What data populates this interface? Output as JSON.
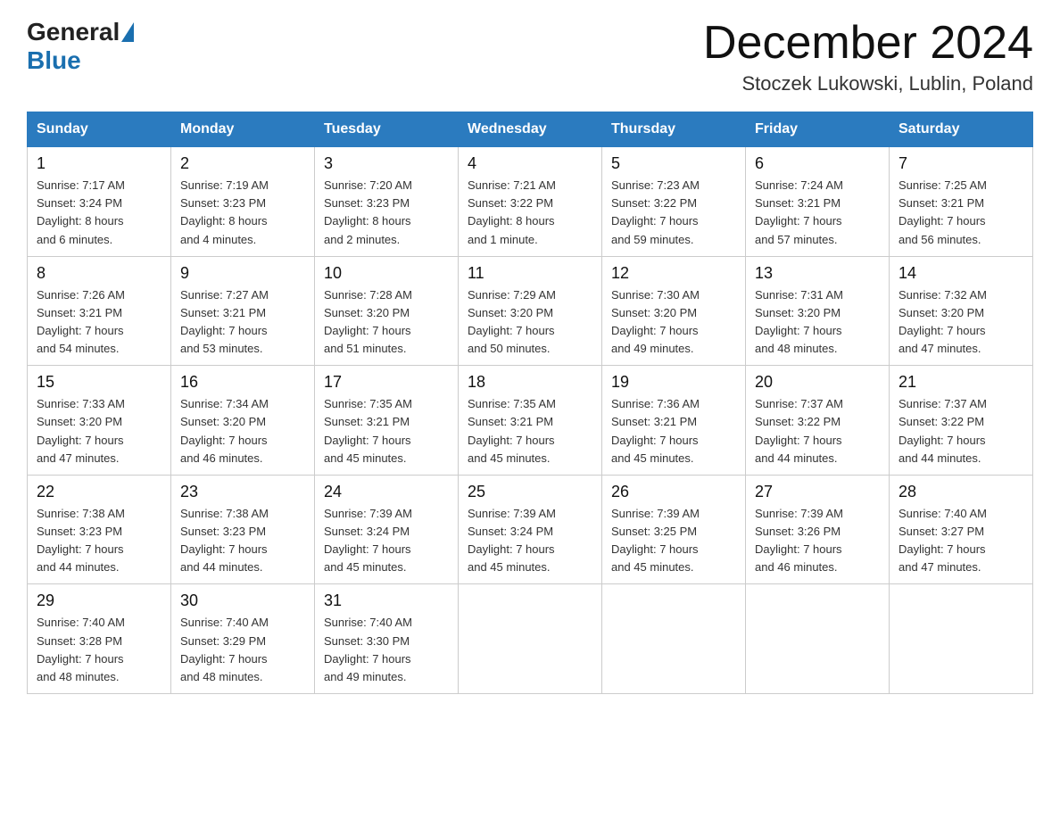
{
  "header": {
    "title": "December 2024",
    "location": "Stoczek Lukowski, Lublin, Poland",
    "logo_general": "General",
    "logo_blue": "Blue"
  },
  "days_of_week": [
    "Sunday",
    "Monday",
    "Tuesday",
    "Wednesday",
    "Thursday",
    "Friday",
    "Saturday"
  ],
  "weeks": [
    [
      {
        "day": "1",
        "sunrise": "7:17 AM",
        "sunset": "3:24 PM",
        "daylight": "8 hours and 6 minutes."
      },
      {
        "day": "2",
        "sunrise": "7:19 AM",
        "sunset": "3:23 PM",
        "daylight": "8 hours and 4 minutes."
      },
      {
        "day": "3",
        "sunrise": "7:20 AM",
        "sunset": "3:23 PM",
        "daylight": "8 hours and 2 minutes."
      },
      {
        "day": "4",
        "sunrise": "7:21 AM",
        "sunset": "3:22 PM",
        "daylight": "8 hours and 1 minute."
      },
      {
        "day": "5",
        "sunrise": "7:23 AM",
        "sunset": "3:22 PM",
        "daylight": "7 hours and 59 minutes."
      },
      {
        "day": "6",
        "sunrise": "7:24 AM",
        "sunset": "3:21 PM",
        "daylight": "7 hours and 57 minutes."
      },
      {
        "day": "7",
        "sunrise": "7:25 AM",
        "sunset": "3:21 PM",
        "daylight": "7 hours and 56 minutes."
      }
    ],
    [
      {
        "day": "8",
        "sunrise": "7:26 AM",
        "sunset": "3:21 PM",
        "daylight": "7 hours and 54 minutes."
      },
      {
        "day": "9",
        "sunrise": "7:27 AM",
        "sunset": "3:21 PM",
        "daylight": "7 hours and 53 minutes."
      },
      {
        "day": "10",
        "sunrise": "7:28 AM",
        "sunset": "3:20 PM",
        "daylight": "7 hours and 51 minutes."
      },
      {
        "day": "11",
        "sunrise": "7:29 AM",
        "sunset": "3:20 PM",
        "daylight": "7 hours and 50 minutes."
      },
      {
        "day": "12",
        "sunrise": "7:30 AM",
        "sunset": "3:20 PM",
        "daylight": "7 hours and 49 minutes."
      },
      {
        "day": "13",
        "sunrise": "7:31 AM",
        "sunset": "3:20 PM",
        "daylight": "7 hours and 48 minutes."
      },
      {
        "day": "14",
        "sunrise": "7:32 AM",
        "sunset": "3:20 PM",
        "daylight": "7 hours and 47 minutes."
      }
    ],
    [
      {
        "day": "15",
        "sunrise": "7:33 AM",
        "sunset": "3:20 PM",
        "daylight": "7 hours and 47 minutes."
      },
      {
        "day": "16",
        "sunrise": "7:34 AM",
        "sunset": "3:20 PM",
        "daylight": "7 hours and 46 minutes."
      },
      {
        "day": "17",
        "sunrise": "7:35 AM",
        "sunset": "3:21 PM",
        "daylight": "7 hours and 45 minutes."
      },
      {
        "day": "18",
        "sunrise": "7:35 AM",
        "sunset": "3:21 PM",
        "daylight": "7 hours and 45 minutes."
      },
      {
        "day": "19",
        "sunrise": "7:36 AM",
        "sunset": "3:21 PM",
        "daylight": "7 hours and 45 minutes."
      },
      {
        "day": "20",
        "sunrise": "7:37 AM",
        "sunset": "3:22 PM",
        "daylight": "7 hours and 44 minutes."
      },
      {
        "day": "21",
        "sunrise": "7:37 AM",
        "sunset": "3:22 PM",
        "daylight": "7 hours and 44 minutes."
      }
    ],
    [
      {
        "day": "22",
        "sunrise": "7:38 AM",
        "sunset": "3:23 PM",
        "daylight": "7 hours and 44 minutes."
      },
      {
        "day": "23",
        "sunrise": "7:38 AM",
        "sunset": "3:23 PM",
        "daylight": "7 hours and 44 minutes."
      },
      {
        "day": "24",
        "sunrise": "7:39 AM",
        "sunset": "3:24 PM",
        "daylight": "7 hours and 45 minutes."
      },
      {
        "day": "25",
        "sunrise": "7:39 AM",
        "sunset": "3:24 PM",
        "daylight": "7 hours and 45 minutes."
      },
      {
        "day": "26",
        "sunrise": "7:39 AM",
        "sunset": "3:25 PM",
        "daylight": "7 hours and 45 minutes."
      },
      {
        "day": "27",
        "sunrise": "7:39 AM",
        "sunset": "3:26 PM",
        "daylight": "7 hours and 46 minutes."
      },
      {
        "day": "28",
        "sunrise": "7:40 AM",
        "sunset": "3:27 PM",
        "daylight": "7 hours and 47 minutes."
      }
    ],
    [
      {
        "day": "29",
        "sunrise": "7:40 AM",
        "sunset": "3:28 PM",
        "daylight": "7 hours and 48 minutes."
      },
      {
        "day": "30",
        "sunrise": "7:40 AM",
        "sunset": "3:29 PM",
        "daylight": "7 hours and 48 minutes."
      },
      {
        "day": "31",
        "sunrise": "7:40 AM",
        "sunset": "3:30 PM",
        "daylight": "7 hours and 49 minutes."
      },
      null,
      null,
      null,
      null
    ]
  ],
  "labels": {
    "sunrise": "Sunrise:",
    "sunset": "Sunset:",
    "daylight": "Daylight:"
  }
}
